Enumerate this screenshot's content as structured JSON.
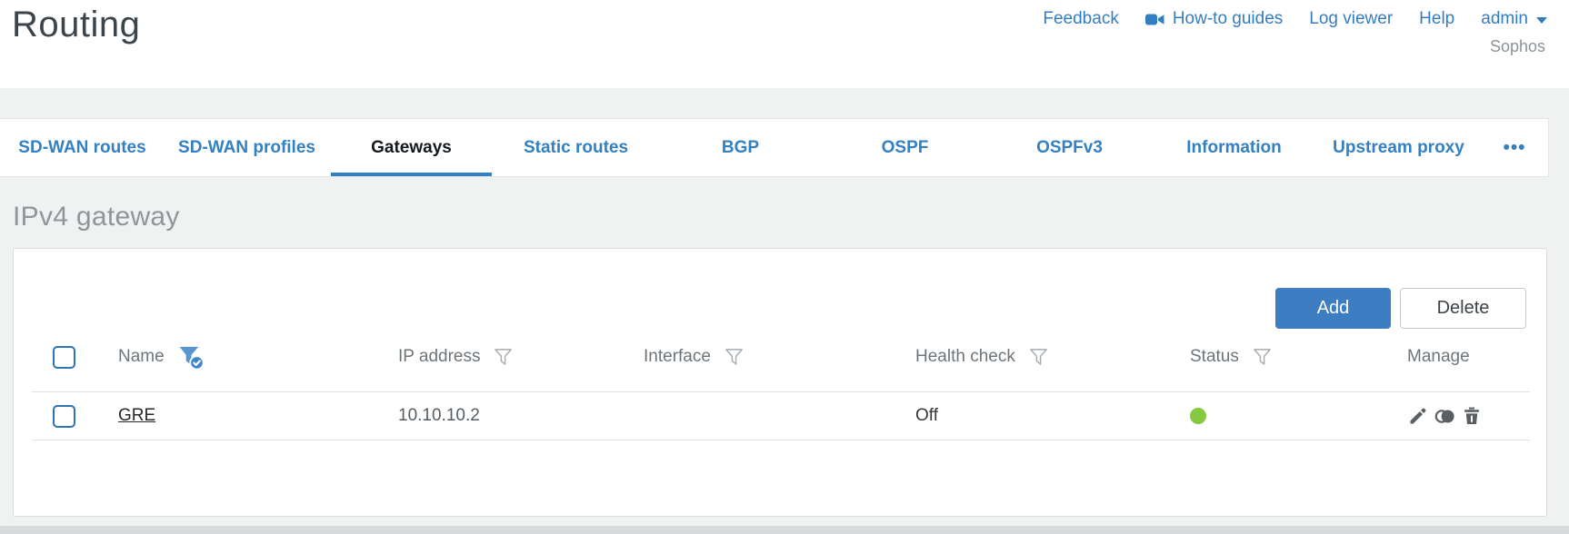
{
  "header": {
    "title": "Routing",
    "brand": "Sophos",
    "nav": {
      "feedback": "Feedback",
      "howto": "How-to guides",
      "log_viewer": "Log viewer",
      "help": "Help",
      "user": "admin"
    }
  },
  "tabs": {
    "items": [
      {
        "label": "SD-WAN routes",
        "active": false
      },
      {
        "label": "SD-WAN profiles",
        "active": false
      },
      {
        "label": "Gateways",
        "active": true
      },
      {
        "label": "Static routes",
        "active": false
      },
      {
        "label": "BGP",
        "active": false
      },
      {
        "label": "OSPF",
        "active": false
      },
      {
        "label": "OSPFv3",
        "active": false
      },
      {
        "label": "Information",
        "active": false
      },
      {
        "label": "Upstream proxy",
        "active": false
      }
    ],
    "overflow": "•••"
  },
  "section": {
    "title": "IPv4 gateway"
  },
  "toolbar": {
    "add_label": "Add",
    "delete_label": "Delete"
  },
  "table": {
    "columns": [
      {
        "label": "Name",
        "filter": "active"
      },
      {
        "label": "IP address",
        "filter": "default"
      },
      {
        "label": "Interface",
        "filter": "default"
      },
      {
        "label": "Health check",
        "filter": "default"
      },
      {
        "label": "Status",
        "filter": "default"
      },
      {
        "label": "Manage",
        "filter": "none"
      }
    ],
    "rows": [
      {
        "name": "GRE",
        "ip_address": "10.10.10.2",
        "interface": "",
        "health_check": "Off",
        "status": "up",
        "selected": false
      }
    ],
    "select_all_checked": false
  },
  "icons": {
    "howto": "video-camera",
    "user_menu": "chevron-down",
    "name_filter": "funnel-check",
    "column_filter": "funnel",
    "manage": [
      "edit-pencil",
      "clone-circles",
      "trash-can"
    ],
    "overflow_tabs": "three-dots"
  },
  "colors": {
    "accent_blue": "#3380c2",
    "button_blue": "#3d7ec3",
    "status_up_green": "#84c93f",
    "icon_gray": "#595f63",
    "page_background": "#f0f1f1"
  }
}
